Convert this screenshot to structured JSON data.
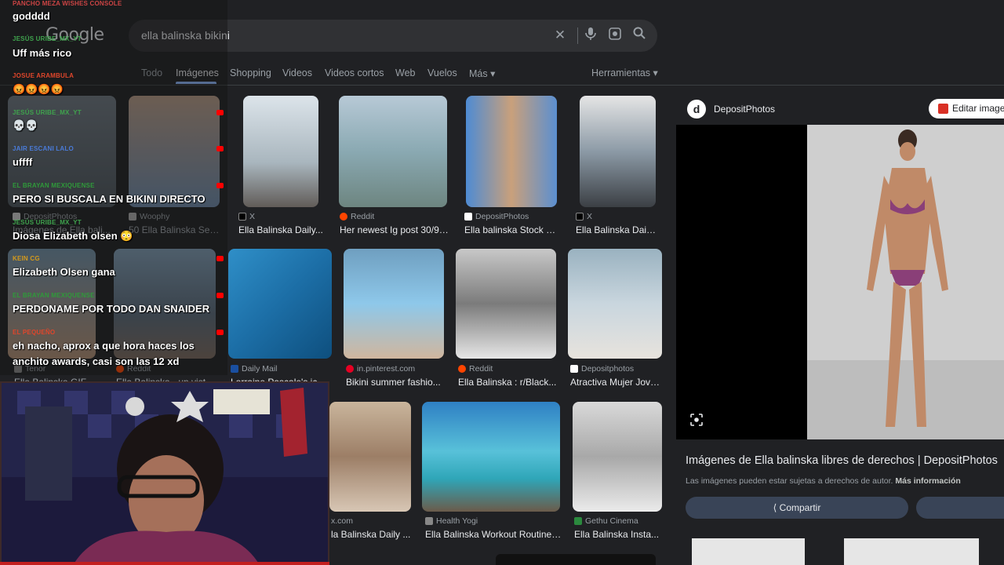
{
  "search": {
    "logo": "Google",
    "query": "ella balinska bikini"
  },
  "tabs": {
    "items": [
      "Todo",
      "Imágenes",
      "Shopping",
      "Videos",
      "Videos cortos",
      "Web",
      "Vuelos",
      "Más ▾"
    ],
    "tools": "Herramientas ▾"
  },
  "results": {
    "row1": [
      {
        "source": "DepositPhotos",
        "caption": "Imágenes de Ella bali..."
      },
      {
        "source": "Woophy",
        "caption": "50 Ella Balinska Sexy..."
      },
      {
        "source": "X",
        "caption": "Ella Balinska Daily..."
      },
      {
        "source": "Reddit",
        "caption": "Her newest Ig post 30/9/..."
      },
      {
        "source": "DepositPhotos",
        "caption": "Ella balinska Stock P..."
      },
      {
        "source": "X",
        "caption": "Ella Balinska Daily..."
      }
    ],
    "row2": [
      {
        "source": "Tenor",
        "caption": "Ella Balinska GIF..."
      },
      {
        "source": "Reddit",
        "caption": "Ella Balinska - un vist..."
      },
      {
        "source": "Daily Mail",
        "caption": "Lorraine Pascale's ice..."
      },
      {
        "source": "in.pinterest.com",
        "caption": "Bikini summer fashio..."
      },
      {
        "source": "Reddit",
        "caption": "Ella Balinska : r/Black..."
      },
      {
        "source": "Depositphotos",
        "caption": "Atractiva Mujer Jove..."
      }
    ],
    "row3": [
      {
        "source": "x.com",
        "caption": "la Balinska Daily ..."
      },
      {
        "source": "Health Yogi",
        "caption": "Ella Balinska Workout Routine ..."
      },
      {
        "source": "Gethu Cinema",
        "caption": "Ella Balinska Insta..."
      }
    ]
  },
  "panel": {
    "site": "DepositPhotos",
    "edit_label": "Editar imagen",
    "title": "Imágenes de Ella balinska libres de derechos | DepositPhotos",
    "subtitle": "Las imágenes pueden estar sujetas a derechos de autor.",
    "more_info": "Más información",
    "share_label": "Compartir"
  },
  "chat": [
    {
      "name": "PANCHO MEZA WISHES CONSOLE",
      "text": "godddd",
      "color": "#c44"
    },
    {
      "name": "JESÚS URIBE_MX_YT",
      "text": "Uff más rico",
      "color": "#3fa34d"
    },
    {
      "name": "JOSUE ARAMBULA",
      "text": "😡😡😡😡",
      "color": "#e0462b"
    },
    {
      "name": "JESÚS URIBE_MX_YT",
      "text": "💀💀",
      "color": "#3fa34d"
    },
    {
      "name": "JAIR ESCANI LALO",
      "text": "uffff",
      "color": "#4a7bd8"
    },
    {
      "name": "EL BRAYAN MEXIQUENSE",
      "text": "PERO SI BUSCALA EN BIKINI DIRECTO",
      "color": "#2f9a3a"
    },
    {
      "name": "JESÚS URIBE_MX_YT",
      "text": "Diosa Elizabeth olsen 😳",
      "color": "#3fa34d"
    },
    {
      "name": "KEIN CG",
      "text": "Elizabeth Olsen gana",
      "color": "#d49a1c"
    },
    {
      "name": "EL BRAYAN MEXIQUENSE",
      "text": "PERDONAME POR TODO DAN SNAIDER",
      "color": "#2f9a3a"
    },
    {
      "name": "EL PEQUEÑO",
      "text": "eh nacho, aprox a que hora haces los",
      "text2": "anchito awards, casi son las 12 xd",
      "color": "#e0462b"
    }
  ],
  "colors": {
    "background": "#202124",
    "searchbox": "#303134",
    "accent": "#8ab4f8",
    "text": "#e8eaed",
    "muted": "#9aa0a6"
  }
}
